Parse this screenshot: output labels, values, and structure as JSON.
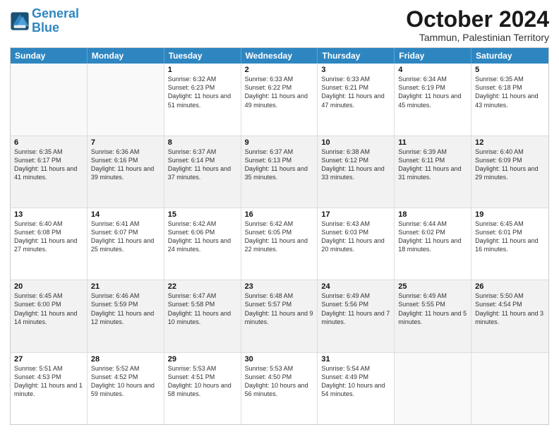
{
  "logo": {
    "line1": "General",
    "line2": "Blue"
  },
  "header": {
    "month": "October 2024",
    "location": "Tammun, Palestinian Territory"
  },
  "weekdays": [
    "Sunday",
    "Monday",
    "Tuesday",
    "Wednesday",
    "Thursday",
    "Friday",
    "Saturday"
  ],
  "rows": [
    [
      {
        "day": "",
        "text": ""
      },
      {
        "day": "",
        "text": ""
      },
      {
        "day": "1",
        "text": "Sunrise: 6:32 AM\nSunset: 6:23 PM\nDaylight: 11 hours and 51 minutes."
      },
      {
        "day": "2",
        "text": "Sunrise: 6:33 AM\nSunset: 6:22 PM\nDaylight: 11 hours and 49 minutes."
      },
      {
        "day": "3",
        "text": "Sunrise: 6:33 AM\nSunset: 6:21 PM\nDaylight: 11 hours and 47 minutes."
      },
      {
        "day": "4",
        "text": "Sunrise: 6:34 AM\nSunset: 6:19 PM\nDaylight: 11 hours and 45 minutes."
      },
      {
        "day": "5",
        "text": "Sunrise: 6:35 AM\nSunset: 6:18 PM\nDaylight: 11 hours and 43 minutes."
      }
    ],
    [
      {
        "day": "6",
        "text": "Sunrise: 6:35 AM\nSunset: 6:17 PM\nDaylight: 11 hours and 41 minutes."
      },
      {
        "day": "7",
        "text": "Sunrise: 6:36 AM\nSunset: 6:16 PM\nDaylight: 11 hours and 39 minutes."
      },
      {
        "day": "8",
        "text": "Sunrise: 6:37 AM\nSunset: 6:14 PM\nDaylight: 11 hours and 37 minutes."
      },
      {
        "day": "9",
        "text": "Sunrise: 6:37 AM\nSunset: 6:13 PM\nDaylight: 11 hours and 35 minutes."
      },
      {
        "day": "10",
        "text": "Sunrise: 6:38 AM\nSunset: 6:12 PM\nDaylight: 11 hours and 33 minutes."
      },
      {
        "day": "11",
        "text": "Sunrise: 6:39 AM\nSunset: 6:11 PM\nDaylight: 11 hours and 31 minutes."
      },
      {
        "day": "12",
        "text": "Sunrise: 6:40 AM\nSunset: 6:09 PM\nDaylight: 11 hours and 29 minutes."
      }
    ],
    [
      {
        "day": "13",
        "text": "Sunrise: 6:40 AM\nSunset: 6:08 PM\nDaylight: 11 hours and 27 minutes."
      },
      {
        "day": "14",
        "text": "Sunrise: 6:41 AM\nSunset: 6:07 PM\nDaylight: 11 hours and 25 minutes."
      },
      {
        "day": "15",
        "text": "Sunrise: 6:42 AM\nSunset: 6:06 PM\nDaylight: 11 hours and 24 minutes."
      },
      {
        "day": "16",
        "text": "Sunrise: 6:42 AM\nSunset: 6:05 PM\nDaylight: 11 hours and 22 minutes."
      },
      {
        "day": "17",
        "text": "Sunrise: 6:43 AM\nSunset: 6:03 PM\nDaylight: 11 hours and 20 minutes."
      },
      {
        "day": "18",
        "text": "Sunrise: 6:44 AM\nSunset: 6:02 PM\nDaylight: 11 hours and 18 minutes."
      },
      {
        "day": "19",
        "text": "Sunrise: 6:45 AM\nSunset: 6:01 PM\nDaylight: 11 hours and 16 minutes."
      }
    ],
    [
      {
        "day": "20",
        "text": "Sunrise: 6:45 AM\nSunset: 6:00 PM\nDaylight: 11 hours and 14 minutes."
      },
      {
        "day": "21",
        "text": "Sunrise: 6:46 AM\nSunset: 5:59 PM\nDaylight: 11 hours and 12 minutes."
      },
      {
        "day": "22",
        "text": "Sunrise: 6:47 AM\nSunset: 5:58 PM\nDaylight: 11 hours and 10 minutes."
      },
      {
        "day": "23",
        "text": "Sunrise: 6:48 AM\nSunset: 5:57 PM\nDaylight: 11 hours and 9 minutes."
      },
      {
        "day": "24",
        "text": "Sunrise: 6:49 AM\nSunset: 5:56 PM\nDaylight: 11 hours and 7 minutes."
      },
      {
        "day": "25",
        "text": "Sunrise: 6:49 AM\nSunset: 5:55 PM\nDaylight: 11 hours and 5 minutes."
      },
      {
        "day": "26",
        "text": "Sunrise: 5:50 AM\nSunset: 4:54 PM\nDaylight: 11 hours and 3 minutes."
      }
    ],
    [
      {
        "day": "27",
        "text": "Sunrise: 5:51 AM\nSunset: 4:53 PM\nDaylight: 11 hours and 1 minute."
      },
      {
        "day": "28",
        "text": "Sunrise: 5:52 AM\nSunset: 4:52 PM\nDaylight: 10 hours and 59 minutes."
      },
      {
        "day": "29",
        "text": "Sunrise: 5:53 AM\nSunset: 4:51 PM\nDaylight: 10 hours and 58 minutes."
      },
      {
        "day": "30",
        "text": "Sunrise: 5:53 AM\nSunset: 4:50 PM\nDaylight: 10 hours and 56 minutes."
      },
      {
        "day": "31",
        "text": "Sunrise: 5:54 AM\nSunset: 4:49 PM\nDaylight: 10 hours and 54 minutes."
      },
      {
        "day": "",
        "text": ""
      },
      {
        "day": "",
        "text": ""
      }
    ]
  ]
}
